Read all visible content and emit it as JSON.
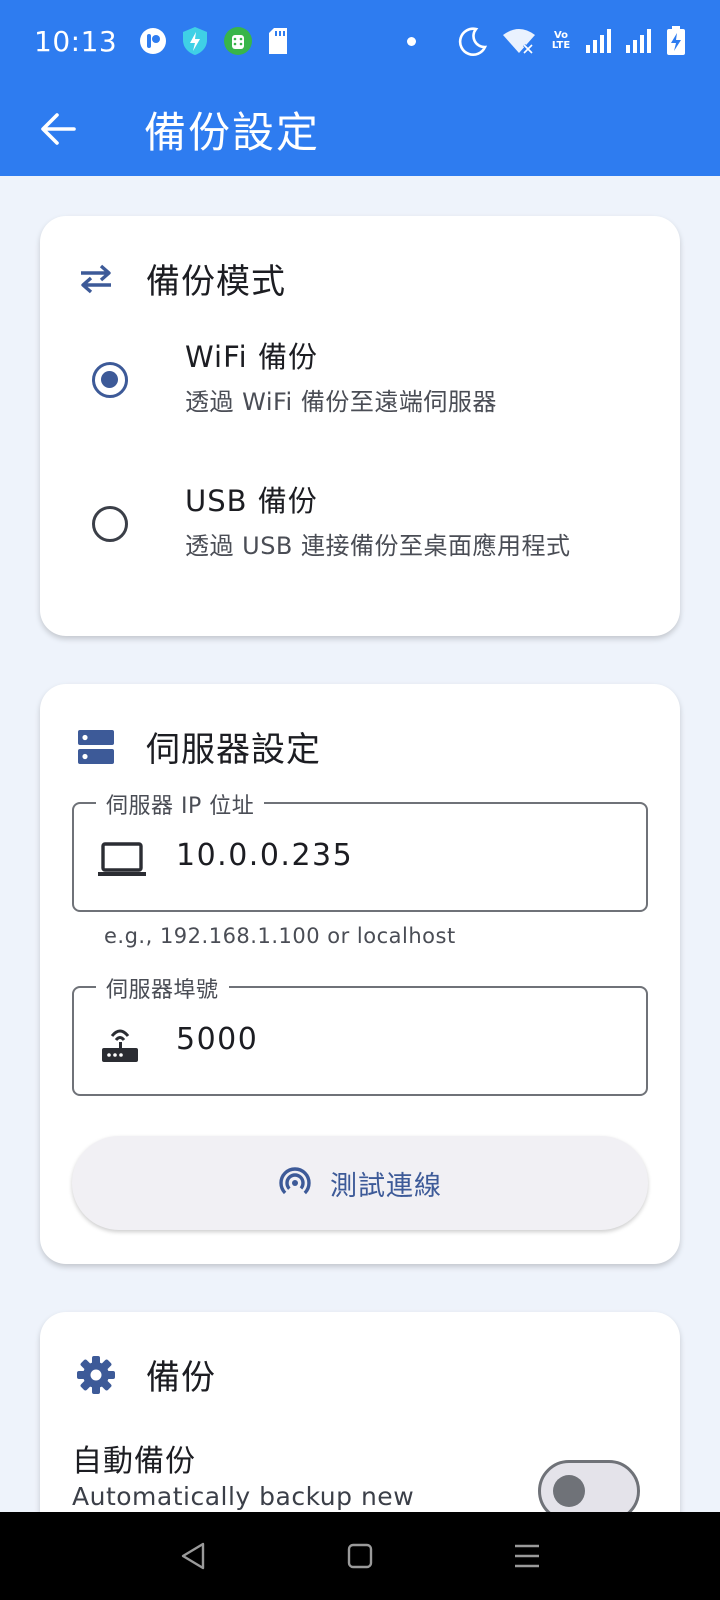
{
  "status_bar": {
    "time": "10:13",
    "left_icons": [
      "app-icon",
      "shield-bolt-icon",
      "android-icon",
      "sd-card-icon"
    ],
    "right_icons": [
      "notification-dot-icon",
      "moon-icon",
      "wifi-icon",
      "volte-icon",
      "signal-icon",
      "signal-icon",
      "battery-charging-icon"
    ],
    "volte_label": "Vo LTE"
  },
  "app_bar": {
    "title": "備份設定",
    "back_icon": "arrow-back-icon"
  },
  "backup_mode": {
    "title": "備份模式",
    "icon": "swap-arrows-icon",
    "options": [
      {
        "title": "WiFi 備份",
        "subtitle": "透過 WiFi 備份至遠端伺服器",
        "selected": true
      },
      {
        "title": "USB 備份",
        "subtitle": "透過 USB 連接備份至桌面應用程式",
        "selected": false
      }
    ]
  },
  "server_settings": {
    "title": "伺服器設定",
    "icon": "dns-server-icon",
    "ip_field": {
      "label": "伺服器 IP 位址",
      "value": "10.0.0.235",
      "helper": "e.g., 192.168.1.100 or localhost",
      "icon": "laptop-icon"
    },
    "port_field": {
      "label": "伺服器埠號",
      "value": "5000",
      "icon": "router-icon"
    },
    "test_button": {
      "label": "測試連線",
      "icon": "broadcast-icon"
    }
  },
  "backup_section": {
    "title": "備份",
    "icon": "gear-icon",
    "auto_backup": {
      "title": "自動備份",
      "subtitle": "Automatically backup new",
      "enabled": false
    }
  },
  "colors": {
    "primary": "#2e7cf0",
    "accent": "#3d5a98",
    "background": "#eef3fb",
    "card": "#ffffff"
  },
  "nav_bar": {
    "buttons": [
      "back-triangle-icon",
      "home-square-icon",
      "menu-lines-icon"
    ]
  }
}
